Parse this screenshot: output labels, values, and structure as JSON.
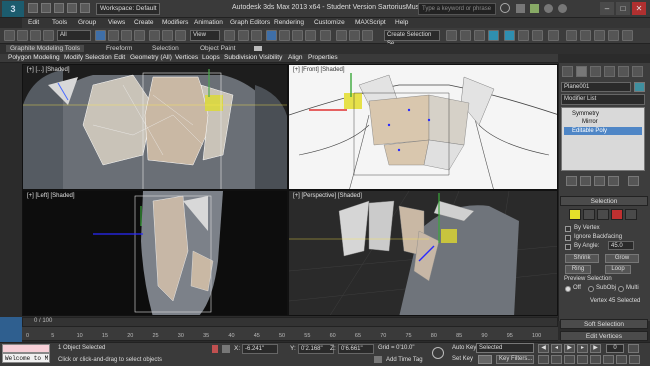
{
  "app": {
    "logo": "3",
    "title": "Autodesk 3ds Max 2013 x64  -  Student Version      SartoriusMuscle.max",
    "workspace": "Workspace: Default",
    "search_placeholder": "Type a keyword or phrase"
  },
  "menu": [
    "Edit",
    "Tools",
    "Group",
    "Views",
    "Create",
    "Modifiers",
    "Animation",
    "Graph Editors",
    "Rendering",
    "Customize",
    "MAXScript",
    "Help"
  ],
  "toolbar": {
    "filter": "All",
    "refcoord": "View",
    "selection_set": "Create Selection Se"
  },
  "ribbon": {
    "tabs": [
      "Graphite Modeling Tools",
      "Freeform",
      "Selection",
      "Object Paint"
    ],
    "subtabs": [
      "Polygon Modeling",
      "Modify Selection",
      "Edit",
      "Geometry (All)",
      "Vertices",
      "Loops",
      "Subdivision",
      "Visibility",
      "Align",
      "Properties"
    ]
  },
  "viewports": {
    "top_left": "[+] [...] [Shaded]",
    "top_right": "[+] [Front] [Shaded]",
    "bottom_left": "[+] [Left] [Shaded]",
    "bottom_right": "[+] [Perspective] [Shaded]"
  },
  "command_panel": {
    "object_name": "Plane001",
    "modifier_list": "Modifier List",
    "stack": [
      "Symmetry",
      "Mirror",
      "Editable Poly"
    ],
    "selection_title": "Selection",
    "by_vertex": "By Vertex",
    "ignore_backfacing": "Ignore Backfacing",
    "by_angle": "By Angle:",
    "angle_value": "45.0",
    "shrink": "Shrink",
    "grow": "Grow",
    "ring": "Ring",
    "loop": "Loop",
    "preview_selection": "Preview Selection",
    "preview_options": [
      "Off",
      "SubObj",
      "Multi"
    ],
    "vertices_selected": "Vertex 45 Selected",
    "soft_selection": "Soft Selection",
    "edit_vertices": "Edit Vertices"
  },
  "timeline": {
    "counter": "0 / 100",
    "ticks": [
      "0",
      "5",
      "10",
      "15",
      "20",
      "25",
      "30",
      "35",
      "40",
      "45",
      "50",
      "55",
      "60",
      "65",
      "70",
      "75",
      "80",
      "85",
      "90",
      "95",
      "100"
    ]
  },
  "status": {
    "maxscript": "Welcome to M",
    "objects_selected": "1 Object Selected",
    "prompt": "Click or click-and-drag to select objects",
    "x_label": "X:",
    "x": "-6.241\"",
    "y_label": "Y:",
    "y": "0'2.168\"",
    "z_label": "Z:",
    "z": "0'6.661\"",
    "grid": "Grid = 0'10.0\"",
    "add_time_tag": "Add Time Tag",
    "auto_key": "Auto Key",
    "selected": "Selected",
    "set_key": "Set Key",
    "key_filters": "Key Filters...",
    "frame": "0"
  }
}
